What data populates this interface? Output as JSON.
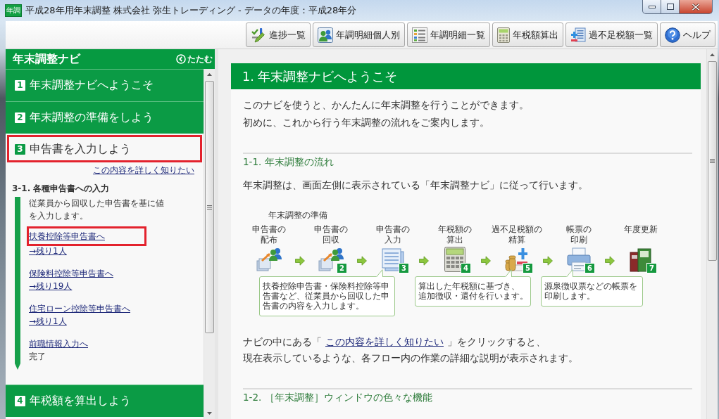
{
  "window": {
    "app_badge": "年調",
    "title": "平成28年用年末調整 株式会社 弥生トレーディング - データの年度：平成28年分"
  },
  "toolbar": [
    "進捗一覧",
    "年調明細個人別",
    "年調明細一覧",
    "年税額算出",
    "過不足税額一覧",
    "ヘルプ"
  ],
  "navi": {
    "title": "年末調整ナビ",
    "collapse": "たたむ",
    "steps": [
      {
        "number": "1",
        "label": "年末調整ナビへようこそ",
        "selected": false,
        "highlighted": false
      },
      {
        "number": "2",
        "label": "年末調整の準備をしよう",
        "selected": false,
        "highlighted": false
      },
      {
        "number": "3",
        "label": "申告書を入力しよう",
        "selected": true,
        "highlighted": true,
        "detail": {
          "link": "この内容を詳しく知りたい",
          "section_title": "3-1. 各種申告書への入力",
          "description": [
            "従業員から回収した申告書を基に値",
            "を入力します。"
          ],
          "tasks": [
            {
              "link": "扶養控除等申告書へ",
              "status": "→残り1人",
              "kind": "pending",
              "highlighted": true
            },
            {
              "link": "保険料控除等申告書へ",
              "status": "→残り19人",
              "kind": "pending",
              "highlighted": false
            },
            {
              "link": "住宅ローン控除等申告書へ",
              "status": "→残り1人",
              "kind": "pending",
              "highlighted": false
            },
            {
              "link": "前職情報入力へ",
              "status": "完了",
              "kind": "done",
              "highlighted": false
            }
          ]
        }
      },
      {
        "number": "4",
        "label": "年税額を算出しよう",
        "selected": false,
        "highlighted": false
      }
    ]
  },
  "content": {
    "header": "1. 年末調整ナビへようこそ",
    "intro": [
      "このナビを使うと、かんたんに年末調整を行うことができます。",
      "初めに、これから行う年末調整の流れをご案内します。"
    ],
    "sections": [
      {
        "heading": "1-1. 年末調整の流れ",
        "text": "年末調整は、画面左側に表示されている「年末調整ナビ」に従って行います。",
        "flow": {
          "group_label": "年末調整の準備",
          "steps": [
            {
              "label": [
                "申告書の",
                "配布"
              ]
            },
            {
              "label": [
                "申告書の",
                "回収"
              ],
              "badge": "2"
            },
            {
              "label": [
                "申告書の",
                "入力"
              ],
              "badge": "3"
            },
            {
              "label": [
                "年税額の",
                "算出"
              ],
              "badge": "4"
            },
            {
              "label": [
                "過不足税額の",
                "精算"
              ],
              "badge": "5"
            },
            {
              "label": [
                "帳票の",
                "印刷"
              ],
              "badge": "6"
            },
            {
              "label": [
                "年度更新"
              ],
              "badge": "7"
            }
          ],
          "callouts": [
            {
              "lines": [
                "扶養控除申告書・保険料控除等申",
                "告書など、従業員から回収した申",
                "告書の内容を入力します。"
              ]
            },
            {
              "lines": [
                "算出した年税額に基づき、",
                "追加徴収・還付を行います。"
              ]
            },
            {
              "lines": [
                "源泉徴収票などの帳票を",
                "印刷します。"
              ]
            }
          ]
        },
        "note": {
          "before": "ナビの中にある「",
          "link": "この内容を詳しく知りたい",
          "after": "」をクリックすると、",
          "continuation": "現在表示しているような、各フロー内の作業の詳細な説明が表示されます。"
        }
      },
      {
        "heading": "1-2. ［年末調整］ウィンドウの色々な機能"
      }
    ]
  }
}
